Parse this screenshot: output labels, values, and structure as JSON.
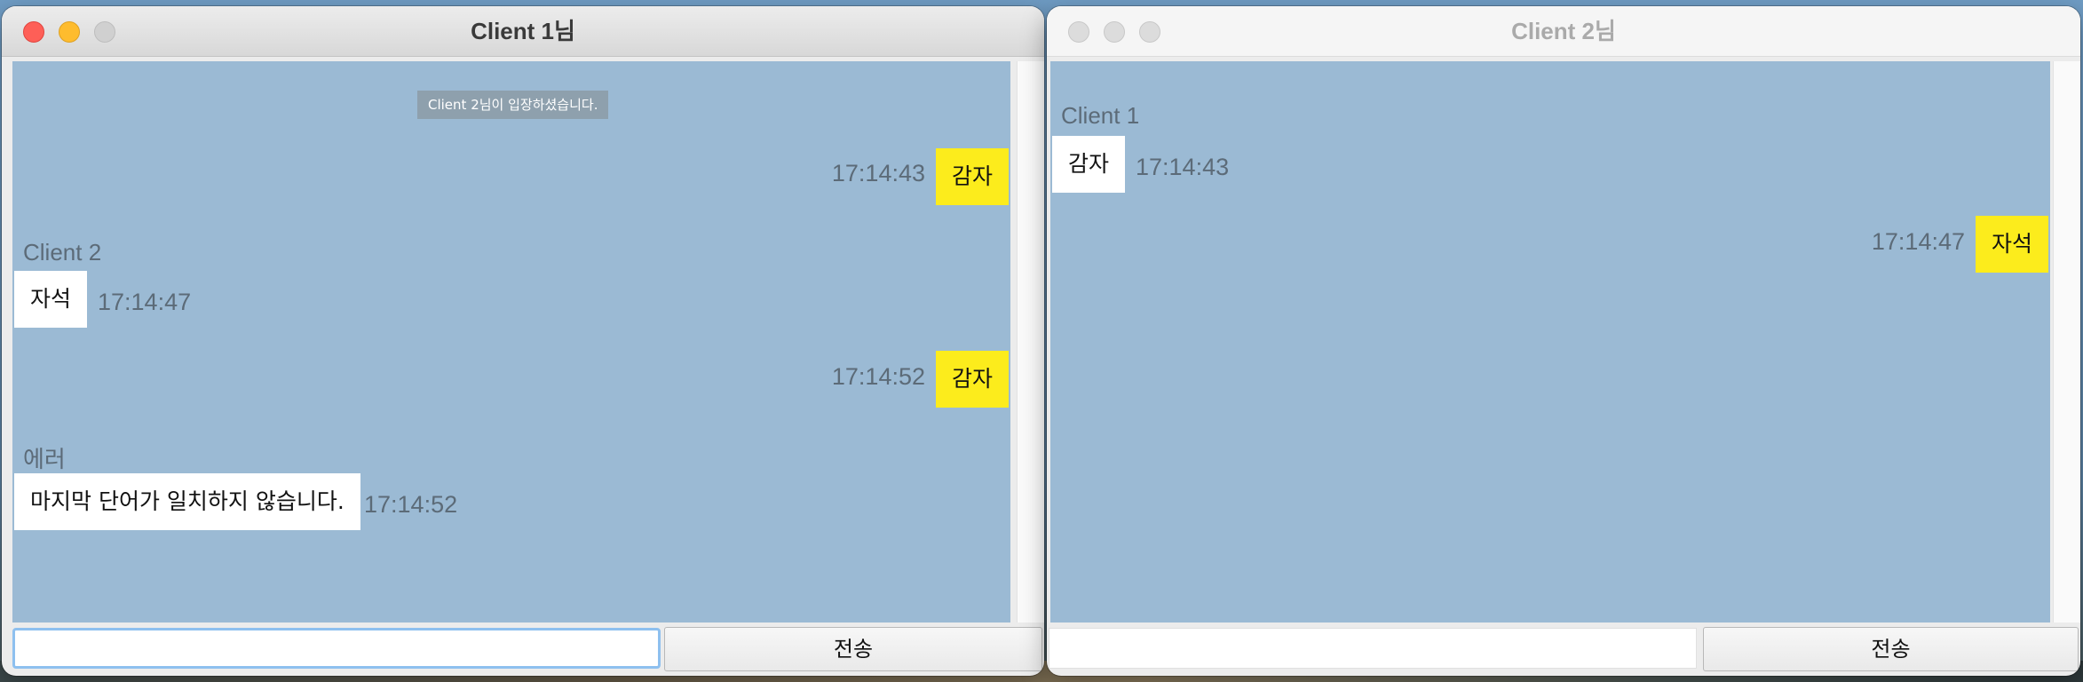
{
  "windows": [
    {
      "title": "Client 1님",
      "system_notice": "Client 2님이 입장하셨습니다.",
      "messages": [
        {
          "kind": "mine",
          "text": "감자",
          "time": "17:14:43"
        },
        {
          "kind": "theirs",
          "sender": "Client 2",
          "text": "자석",
          "time": "17:14:47"
        },
        {
          "kind": "mine",
          "text": "감자",
          "time": "17:14:52"
        },
        {
          "kind": "theirs",
          "sender": "에러",
          "text": "마지막 단어가 일치하지 않습니다.",
          "time": "17:14:52"
        }
      ],
      "input_value": "",
      "send_label": "전송"
    },
    {
      "title": "Client 2님",
      "messages": [
        {
          "kind": "theirs",
          "sender": "Client 1",
          "text": "감자",
          "time": "17:14:43"
        },
        {
          "kind": "mine",
          "text": "자석",
          "time": "17:14:47"
        }
      ],
      "input_value": "",
      "send_label": "전송"
    }
  ],
  "colors": {
    "chat_bg": "#9bbad4",
    "my_bubble": "#fcec1c",
    "their_bubble": "#ffffff",
    "close": "#fe5f57",
    "minimize": "#febc2e"
  }
}
